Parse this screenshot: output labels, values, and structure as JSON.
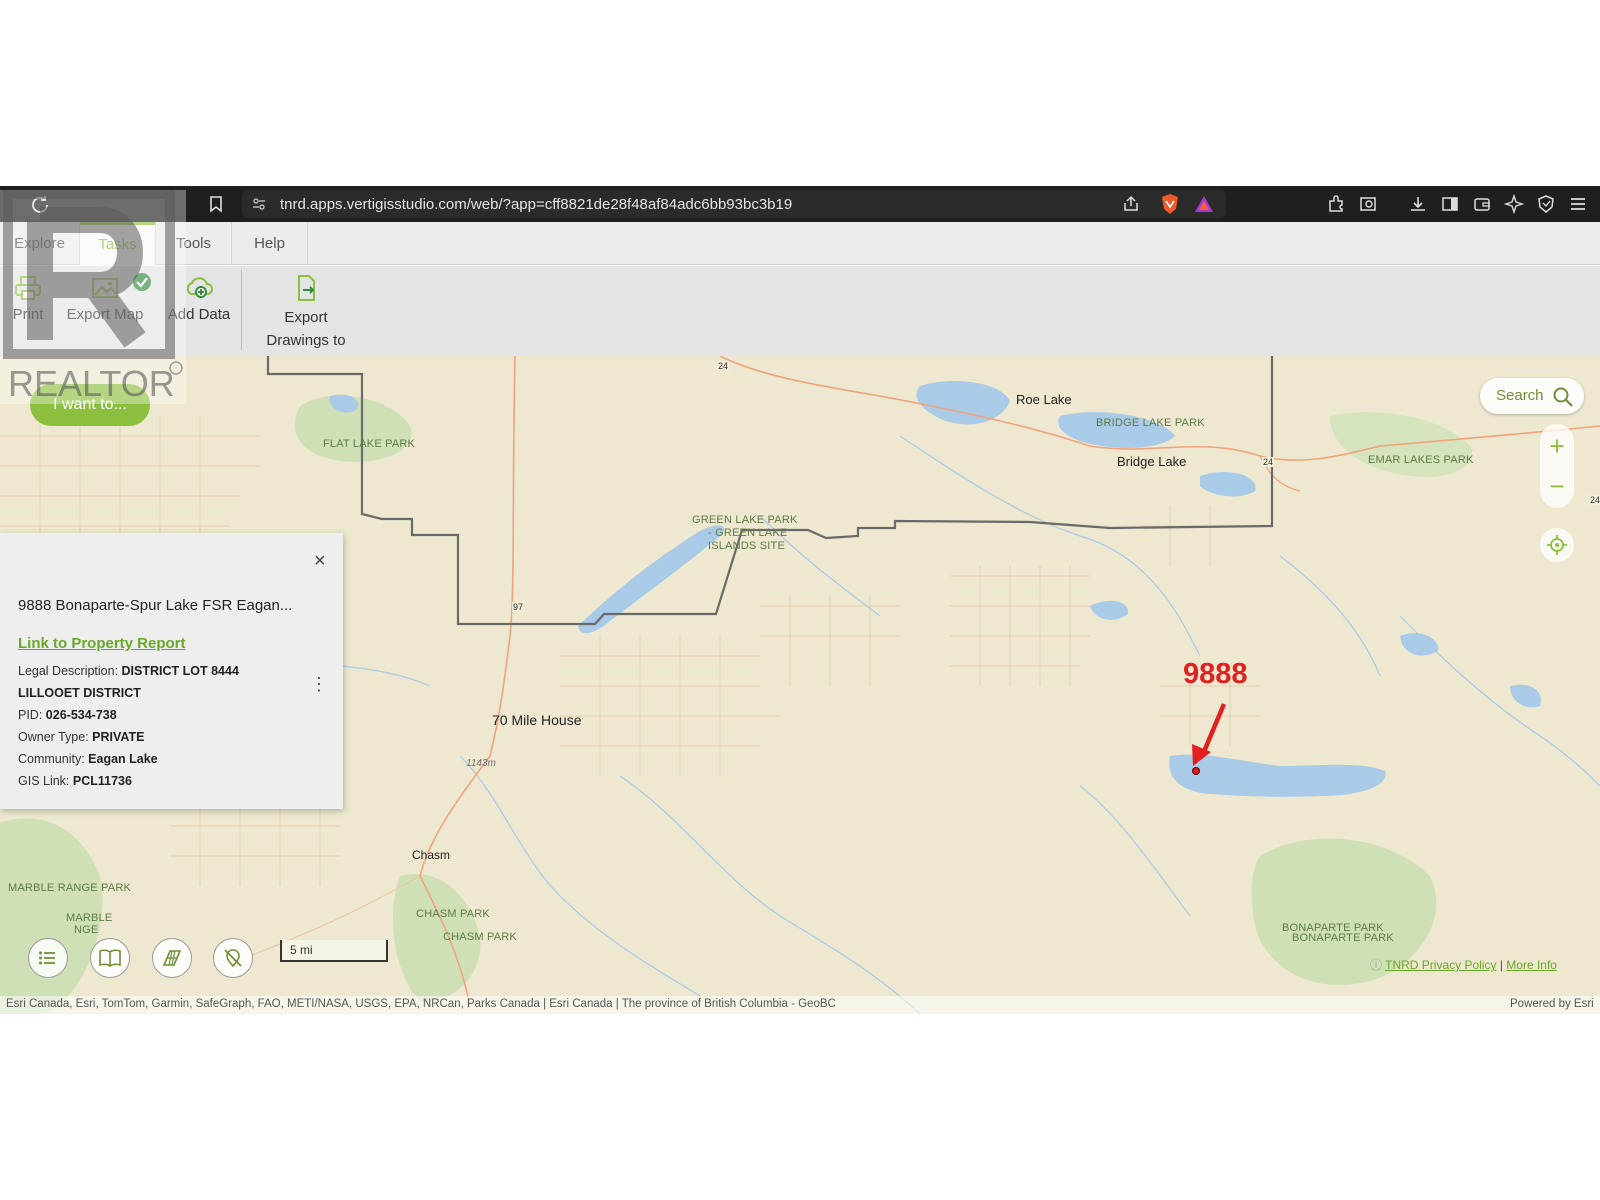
{
  "browser": {
    "url": "tnrd.apps.vertigisstudio.com/web/?app=cff8821de28f48af84adc6bb93bc3b19"
  },
  "ribbon": {
    "tabs": [
      {
        "label": "Explore"
      },
      {
        "label": "Tasks"
      },
      {
        "label": "Tools"
      },
      {
        "label": "Help"
      }
    ],
    "tools": {
      "print": "Print",
      "export_map": "Export Map",
      "add_data": "Add Data",
      "export_drawings_1": "Export",
      "export_drawings_2": "Drawings to"
    }
  },
  "map": {
    "i_want_to": "I want to...",
    "search_label": "Search",
    "zoom_in": "+",
    "zoom_out": "−",
    "scale_label": "5 mi",
    "annotation": "9888",
    "labels": {
      "flat_lake_park": "FLAT LAKE PARK",
      "roe_lake": "Roe Lake",
      "bridge_lake_park": "BRIDGE LAKE PARK",
      "bridge_lake": "Bridge Lake",
      "emar_lakes_park": "EMAR LAKES PARK",
      "green_lake_1": "GREEN LAKE PARK",
      "green_lake_2": "- GREEN LAKE",
      "green_lake_3": "ISLANDS SITE",
      "seventy_mile": "70 Mile House",
      "elevation": "1143m",
      "chasm": "Chasm",
      "marble_range": "MARBLE RANGE PARK",
      "marble_2": "MARBLE",
      "marble_3": "NGE",
      "chasm_park_1": "CHASM PARK",
      "chasm_park_2": "CHASM PARK",
      "bonaparte_1": "BONAPARTE PARK",
      "bonaparte_2": "BONAPARTE PARK",
      "hwy_24a": "24",
      "hwy_24b": "24",
      "hwy_24c": "24",
      "hwy_97": "97"
    },
    "privacy_link": "TNRD Privacy Policy",
    "privacy_sep": " | ",
    "more_info": "More Info",
    "attribution": "Esri Canada, Esri, TomTom, Garmin, SafeGraph, FAO, METI/NASA, USGS, EPA, NRCan, Parks Canada | Esri Canada | The province of British Columbia - GeoBC",
    "powered_by": "Powered by Esri"
  },
  "popup": {
    "title": "9888 Bonaparte-Spur Lake FSR Eagan...",
    "link": "Link to Property Report",
    "close": "×",
    "fields": [
      {
        "label": "Legal Description: ",
        "value": "DISTRICT LOT 8444"
      },
      {
        "label": "",
        "value": "LILLOOET DISTRICT"
      },
      {
        "label": "PID: ",
        "value": "026-534-738"
      },
      {
        "label": "Owner Type: ",
        "value": "PRIVATE"
      },
      {
        "label": "Community: ",
        "value": "Eagan Lake"
      },
      {
        "label": "GIS Link: ",
        "value": "PCL11736"
      }
    ]
  },
  "watermark": {
    "text": "REALTOR"
  },
  "colors": {
    "accent": "#8dbf3f",
    "map_bg": "#ede8cf",
    "water": "#a9cbe8",
    "park": "#cfe0b6",
    "annotation": "#e31f1f"
  }
}
